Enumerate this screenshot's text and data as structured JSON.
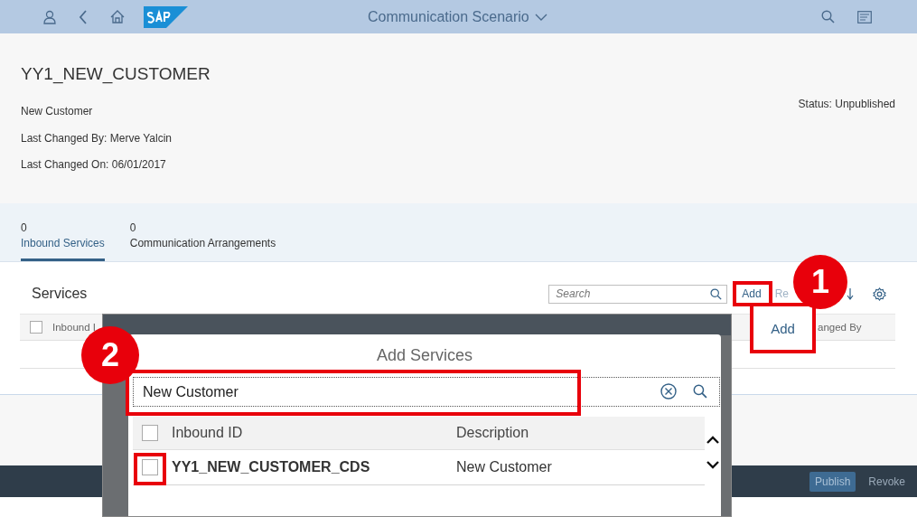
{
  "shell": {
    "title": "Communication Scenario"
  },
  "header": {
    "title": "YY1_NEW_CUSTOMER",
    "description": "New Customer",
    "last_changed_by": "Last Changed By: Merve Yalcin",
    "last_changed_on": "Last Changed On: 06/01/2017",
    "status": "Status: Unpublished"
  },
  "tabs": [
    {
      "count": "0",
      "label": "Inbound Services",
      "selected": true
    },
    {
      "count": "0",
      "label": "Communication Arrangements",
      "selected": false
    }
  ],
  "services": {
    "title": "Services",
    "search": {
      "placeholder": "Search"
    },
    "add": "Add",
    "remove": "Re",
    "all_selected": false,
    "columns": [
      "Inbound I",
      "anged By"
    ]
  },
  "footer": {
    "buttons": [
      {
        "label": "Publish",
        "kind": "primary"
      },
      {
        "label": "Revoke",
        "kind": "plain"
      }
    ]
  },
  "dialog": {
    "title": "Add Services",
    "search": {
      "value": "New Customer"
    },
    "all_selected": false,
    "columns": [
      "Inbound ID",
      "Description"
    ],
    "rows": [
      {
        "id": "YY1_NEW_CUSTOMER_CDS",
        "description": "New Customer",
        "checked": false
      }
    ]
  },
  "popup": {
    "label": "Add"
  },
  "callouts": [
    {
      "number": "1"
    },
    {
      "number": "2"
    }
  ]
}
